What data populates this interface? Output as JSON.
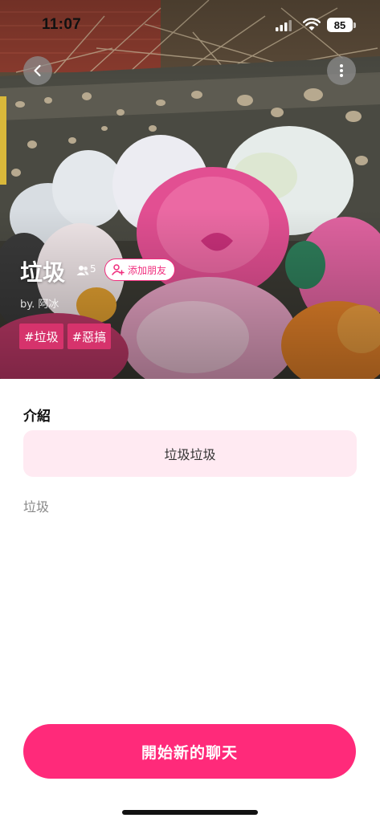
{
  "status_bar": {
    "time": "11:07",
    "battery": "85"
  },
  "hero": {
    "title": "垃圾",
    "member_count": "5",
    "add_friend_label": "添加朋友",
    "creator": "by. 阿冰",
    "tags": [
      "#垃圾",
      "#惡搞"
    ]
  },
  "intro": {
    "section_title": "介紹",
    "box_text": "垃圾垃圾",
    "description": "垃圾"
  },
  "actions": {
    "start_chat_label": "開始新的聊天"
  },
  "colors": {
    "accent": "#ff2a7a",
    "tag_bg": "#d6336c",
    "intro_box_bg": "#ffeaf2"
  },
  "icons": {
    "back": "chevron-left-icon",
    "more": "more-vertical-icon",
    "members": "people-icon",
    "add_friend": "person-add-icon"
  }
}
